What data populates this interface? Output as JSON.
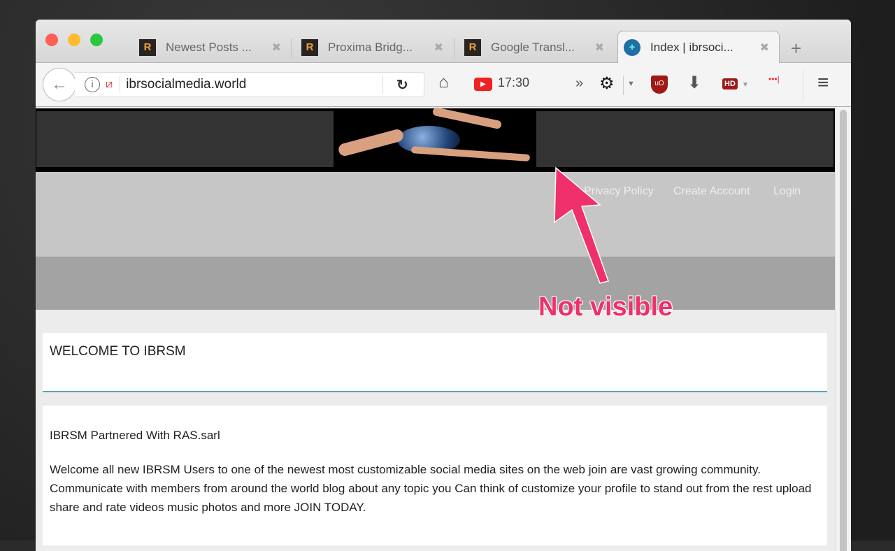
{
  "browser": {
    "tabs": [
      {
        "label": "Newest Posts ...",
        "active": false
      },
      {
        "label": "Proxima Bridg...",
        "active": false
      },
      {
        "label": "Google Transl...",
        "active": false
      },
      {
        "label": "Index | ibrsoci...",
        "active": true
      }
    ],
    "new_tab": "+",
    "close_glyph": "✖",
    "url": "ibrsocialmedia.world",
    "youtube_time": "17:30",
    "hd_label": "HD",
    "ublock_label": "uO"
  },
  "site": {
    "nav": [
      "Privacy Policy",
      "Create Account",
      "Login"
    ],
    "welcome_title": "WELCOME TO IBRSM",
    "post_title": "IBRSM Partnered With RAS.sarl",
    "post_body": "Welcome all new IBRSM Users to one of the newest most customizable social media sites on the web join are vast growing community. Communicate with members from around the world blog about any topic you Can think of customize your profile to stand out from the rest upload share and rate videos music photos and more JOIN TODAY."
  },
  "annotation": {
    "text": "Not visible",
    "color": "#f0306a"
  }
}
